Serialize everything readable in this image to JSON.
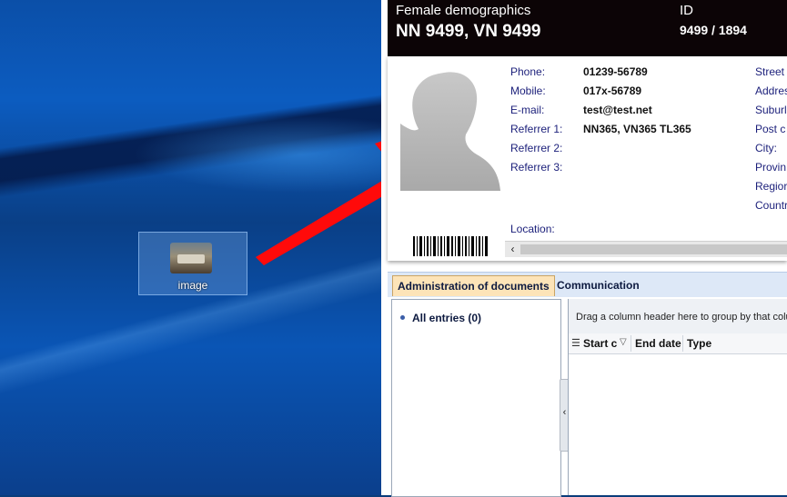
{
  "desktop": {
    "icon_label": "image"
  },
  "header": {
    "title": "Female demographics",
    "name": "NN 9499, VN 9499",
    "id_label": "ID",
    "id_value": "9499 / 1894"
  },
  "contact": {
    "phone_label": "Phone:",
    "phone": "01239-56789",
    "mobile_label": "Mobile:",
    "mobile": "017x-56789",
    "email_label": "E-mail:",
    "email": "test@test.net",
    "referrer1_label": "Referrer 1:",
    "referrer1": "NN365, VN365 TL365",
    "referrer2_label": "Referrer 2:",
    "referrer3_label": "Referrer 3:",
    "location_label": "Location:"
  },
  "address": {
    "street_label": "Street",
    "address_label": "Addres",
    "suburb_label": "Suburl",
    "postcode_label": "Post c",
    "city_label": "City:",
    "province_label": "Provin",
    "region_label": "Regior",
    "country_label": "Countr"
  },
  "scrollbar": {
    "left_arrow": "‹"
  },
  "tabs": {
    "active": "Administration of documents",
    "other": "Communication"
  },
  "tree": {
    "all_entries": "All entries (0)"
  },
  "grid": {
    "group_hint": "Drag a column header here to group by that colu",
    "columns": [
      "Start c",
      "End date",
      "Type"
    ]
  },
  "splitter": {
    "arrow": "‹"
  }
}
